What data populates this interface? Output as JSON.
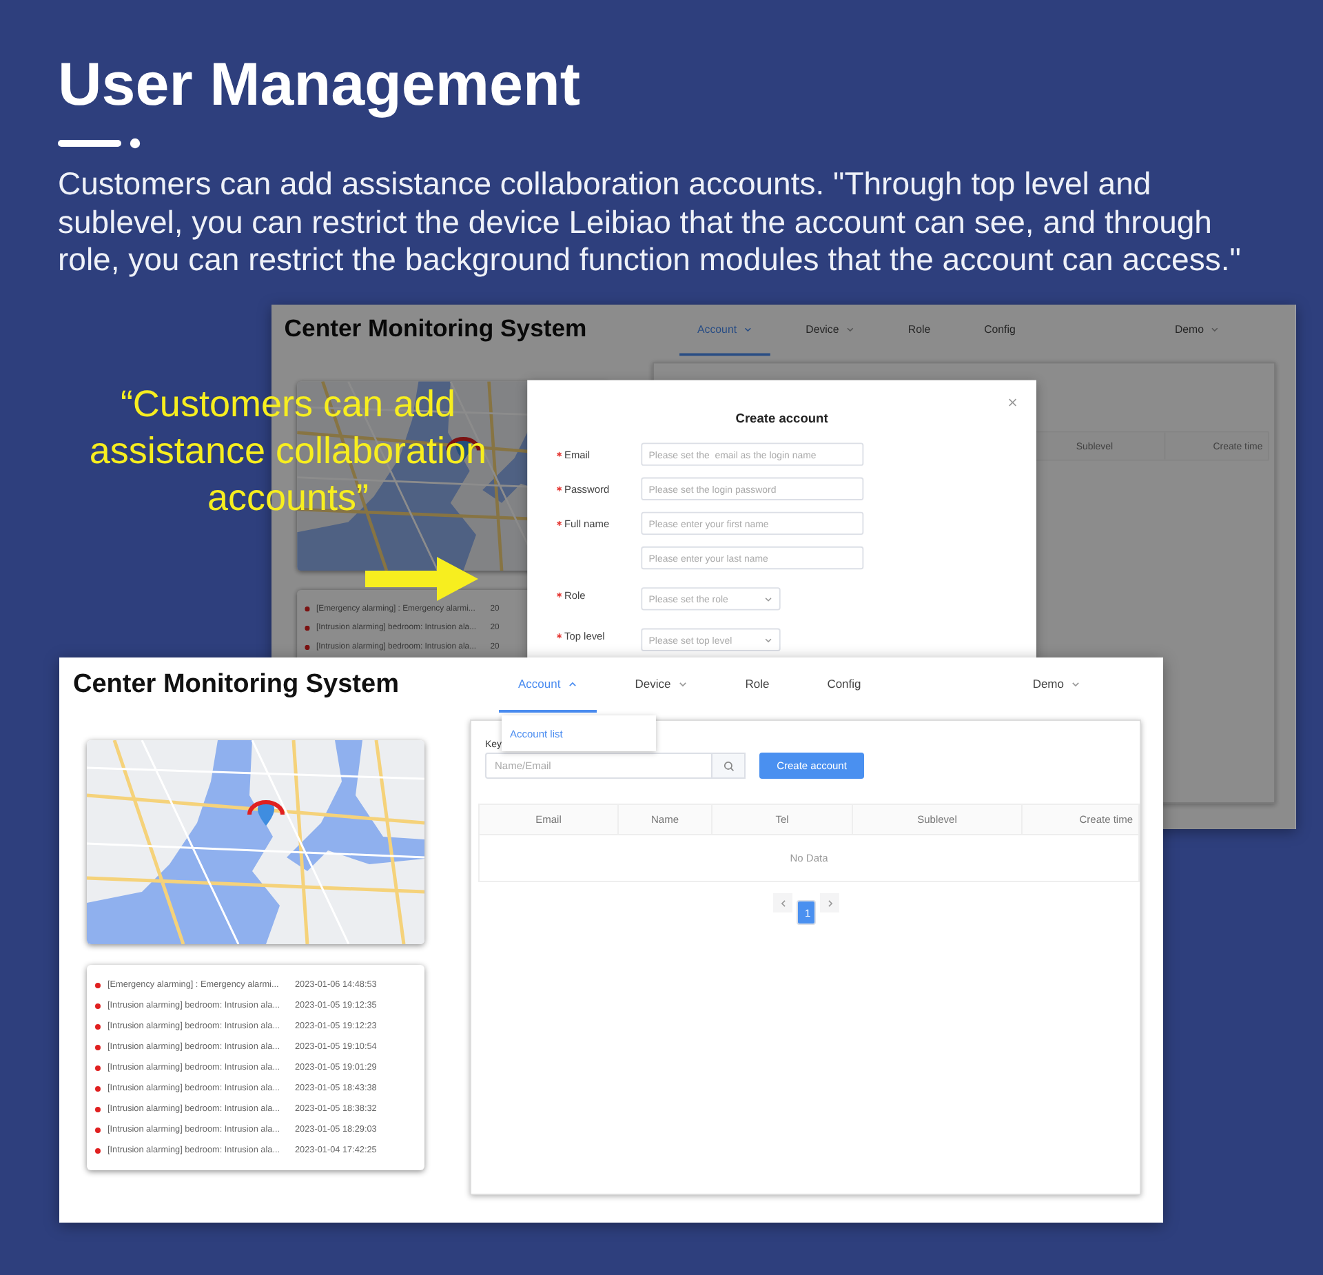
{
  "heading": "User Management",
  "description": "Customers can add assistance collaboration accounts. \"Through top level and sublevel, you can restrict the device Leibiao that the account can see, and through role, you can restrict the background function modules that the account can access.\"",
  "back_window": {
    "title": "Center Monitoring System",
    "nav": [
      {
        "label": "Account",
        "selected": true,
        "kind": "dropdown",
        "expanded": false
      },
      {
        "label": "Device",
        "selected": false,
        "kind": "dropdown",
        "expanded": false
      },
      {
        "label": "Role",
        "selected": false,
        "kind": "link"
      },
      {
        "label": "Config",
        "selected": false,
        "kind": "link"
      }
    ],
    "user_menu": "Demo",
    "alarms": [
      {
        "text": "[Emergency alarming] : Emergency alarmi...",
        "time": "20"
      },
      {
        "text": "[Intrusion alarming] bedroom: Intrusion ala...",
        "time": "20"
      },
      {
        "text": "[Intrusion alarming] bedroom: Intrusion ala...",
        "time": "20"
      }
    ],
    "table": {
      "columns": [
        "Sublevel",
        "Create time"
      ]
    },
    "dialog": {
      "title": "Create account",
      "fields": [
        {
          "label": "Email",
          "required": true,
          "kind": "input",
          "placeholder": "Please set the  email as the login name"
        },
        {
          "label": "Password",
          "required": true,
          "kind": "input",
          "placeholder": "Please set the login password"
        },
        {
          "label": "Full name",
          "required": true,
          "kind": "input",
          "placeholder": "Please enter your first name"
        },
        {
          "kind": "input",
          "placeholder": "Please enter your last name"
        },
        {
          "label": "Role",
          "required": true,
          "kind": "select",
          "placeholder": "Please set the role"
        },
        {
          "label": "Top level",
          "required": true,
          "kind": "select",
          "placeholder": "Please set top level"
        }
      ]
    }
  },
  "callout": "“Customers can add assistance collaboration accounts”",
  "front_window": {
    "title": "Center Monitoring System",
    "nav": [
      {
        "label": "Account",
        "selected": true,
        "kind": "dropdown",
        "expanded": true
      },
      {
        "label": "Device",
        "selected": false,
        "kind": "dropdown",
        "expanded": false
      },
      {
        "label": "Role",
        "selected": false,
        "kind": "link"
      },
      {
        "label": "Config",
        "selected": false,
        "kind": "link"
      }
    ],
    "user_menu": "Demo",
    "nav_menu": [
      {
        "label": "Account list"
      }
    ],
    "alarms": [
      {
        "text": "[Emergency alarming] : Emergency alarmi...",
        "time": "2023-01-06 14:48:53"
      },
      {
        "text": "[Intrusion alarming] bedroom: Intrusion ala...",
        "time": "2023-01-05 19:12:35"
      },
      {
        "text": "[Intrusion alarming] bedroom: Intrusion ala...",
        "time": "2023-01-05 19:12:23"
      },
      {
        "text": "[Intrusion alarming] bedroom: Intrusion ala...",
        "time": "2023-01-05 19:10:54"
      },
      {
        "text": "[Intrusion alarming] bedroom: Intrusion ala...",
        "time": "2023-01-05 19:01:29"
      },
      {
        "text": "[Intrusion alarming] bedroom: Intrusion ala...",
        "time": "2023-01-05 18:43:38"
      },
      {
        "text": "[Intrusion alarming] bedroom: Intrusion ala...",
        "time": "2023-01-05 18:38:32"
      },
      {
        "text": "[Intrusion alarming] bedroom: Intrusion ala...",
        "time": "2023-01-05 18:29:03"
      },
      {
        "text": "[Intrusion alarming] bedroom: Intrusion ala...",
        "time": "2023-01-04 17:42:25"
      }
    ],
    "search": {
      "label": "Key",
      "placeholder": "Name/Email"
    },
    "create_button": "Create account",
    "table": {
      "columns": [
        "Email",
        "Name",
        "Tel",
        "Sublevel",
        "Create time"
      ],
      "empty_text": "No Data"
    },
    "pagination": [
      {
        "label": "1",
        "selected": true
      }
    ]
  }
}
